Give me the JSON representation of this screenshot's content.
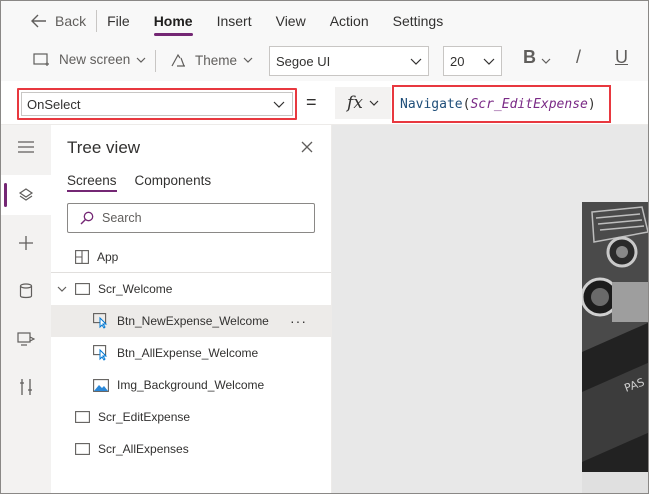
{
  "menubar": {
    "back_label": "Back",
    "items": [
      "File",
      "Home",
      "Insert",
      "View",
      "Action",
      "Settings"
    ],
    "active": "Home"
  },
  "toolbar": {
    "new_screen_label": "New screen",
    "theme_label": "Theme",
    "font_value": "Segoe UI",
    "size_value": "20",
    "bold_label": "B",
    "italic_label": "/",
    "underline_label": "U"
  },
  "formulabar": {
    "property": "OnSelect",
    "equals": "=",
    "fx_label": "fx",
    "formula_fn": "Navigate",
    "formula_open": "(",
    "formula_arg": "Scr_EditExpense",
    "formula_close": ")"
  },
  "tree": {
    "title": "Tree view",
    "tabs": [
      "Screens",
      "Components"
    ],
    "search_placeholder": "Search",
    "nodes": {
      "app": "App",
      "scr_welcome": "Scr_Welcome",
      "btn_new": "Btn_NewExpense_Welcome",
      "btn_all": "Btn_AllExpense_Welcome",
      "img_bg": "Img_Background_Welcome",
      "scr_edit": "Scr_EditExpense",
      "scr_all": "Scr_AllExpenses"
    },
    "more_label": "···"
  },
  "colors": {
    "accent": "#742774",
    "highlight": "#e8383f"
  }
}
